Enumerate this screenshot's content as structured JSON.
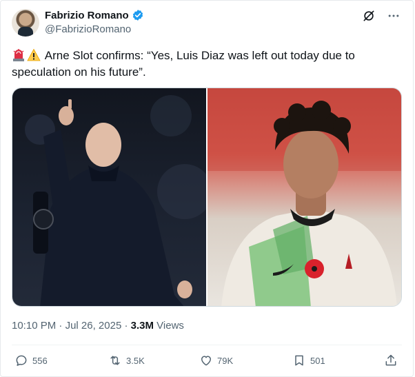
{
  "author": {
    "name": "Fabrizio Romano",
    "handle": "@FabrizioRomano",
    "verified": true,
    "verified_color": "#1d9bf0"
  },
  "tweet": {
    "emojis": [
      "rotating-light",
      "warning"
    ],
    "text": "Arne Slot confirms: “Yes, Luis Diaz was left out today due to speculation on his future”."
  },
  "media": [
    {
      "description_icon": "photo-arne-slot"
    },
    {
      "description_icon": "photo-luis-diaz"
    }
  ],
  "meta": {
    "time": "10:10 PM",
    "separator": "·",
    "date": "Jul 26, 2025",
    "views_count": "3.3M",
    "views_label": "Views"
  },
  "actions": {
    "replies": "556",
    "reposts": "3.5K",
    "likes": "79K",
    "bookmarks": "501"
  },
  "colors": {
    "text_primary": "#0f1419",
    "text_secondary": "#536471",
    "accent": "#1d9bf0"
  }
}
